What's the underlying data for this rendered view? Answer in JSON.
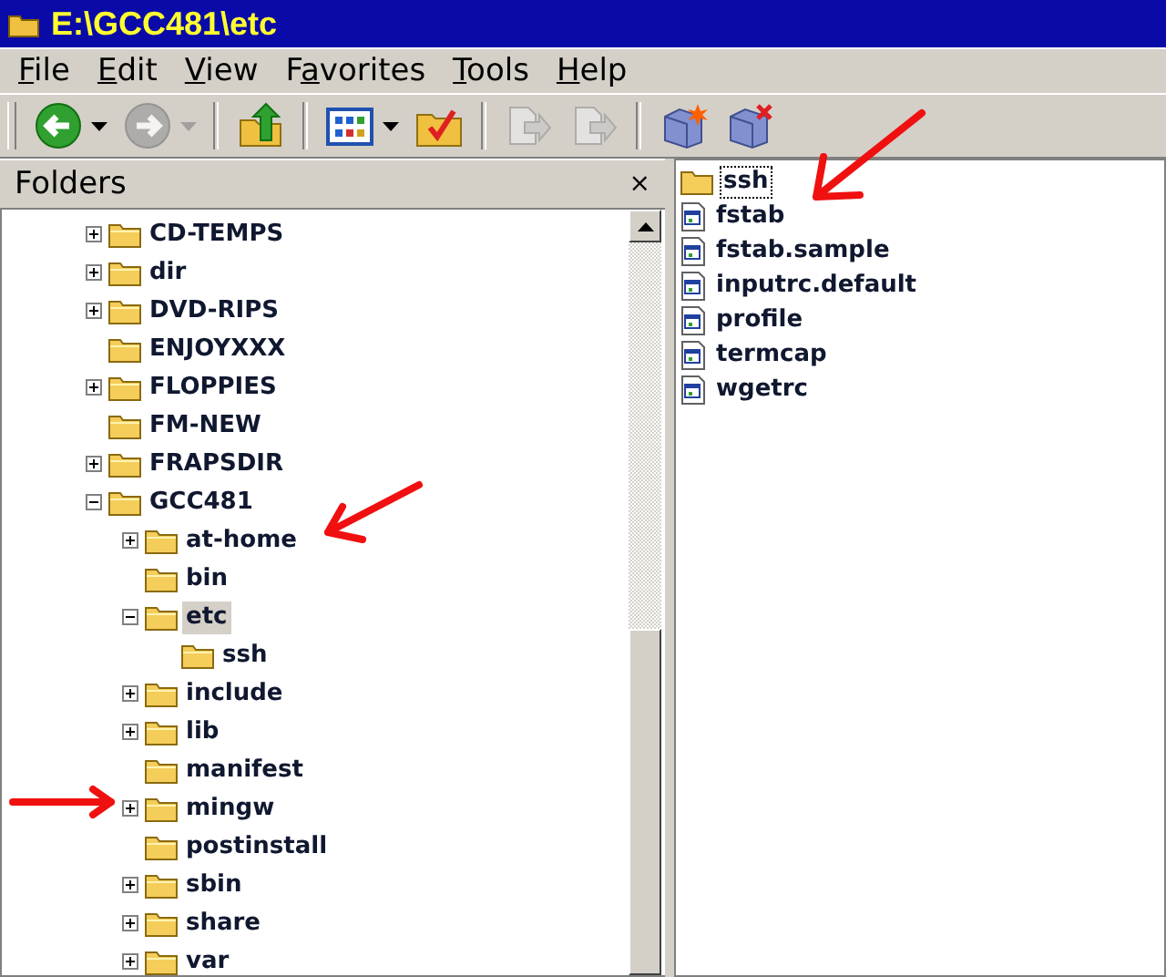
{
  "window": {
    "title": "E:\\GCC481\\etc"
  },
  "menu": [
    {
      "key": "F",
      "after": "ile"
    },
    {
      "key": "E",
      "after": "dit"
    },
    {
      "key": "V",
      "after": "iew"
    },
    {
      "before": "F",
      "key": "a",
      "after": "vorites"
    },
    {
      "key": "T",
      "after": "ools"
    },
    {
      "key": "H",
      "after": "elp"
    }
  ],
  "toolbar": [
    {
      "kind": "back",
      "disabled": false,
      "dropdown": true
    },
    {
      "kind": "forward",
      "disabled": true,
      "dropdown": true
    },
    {
      "kind": "separator"
    },
    {
      "kind": "up",
      "disabled": false,
      "dropdown": false
    },
    {
      "kind": "separator"
    },
    {
      "kind": "views",
      "disabled": false,
      "dropdown": true
    },
    {
      "kind": "folders",
      "disabled": false,
      "dropdown": false
    },
    {
      "kind": "separator"
    },
    {
      "kind": "move",
      "disabled": true,
      "dropdown": false
    },
    {
      "kind": "copy",
      "disabled": true,
      "dropdown": false
    },
    {
      "kind": "separator"
    },
    {
      "kind": "map-drive",
      "disabled": false,
      "dropdown": false
    },
    {
      "kind": "disconnect",
      "disabled": false,
      "dropdown": false
    }
  ],
  "folders_pane": {
    "title": "Folders",
    "close": "×",
    "tree": [
      {
        "name": "CD-TEMPS",
        "expandable": true,
        "selected": false
      },
      {
        "name": "dir",
        "expandable": true,
        "selected": false
      },
      {
        "name": "DVD-RIPS",
        "expandable": true,
        "selected": false
      },
      {
        "name": "ENJOYXXX",
        "expandable": false,
        "selected": false
      },
      {
        "name": "FLOPPIES",
        "expandable": true,
        "selected": false
      },
      {
        "name": "FM-NEW",
        "expandable": false,
        "selected": false
      },
      {
        "name": "FRAPSDIR",
        "expandable": true,
        "selected": false
      },
      {
        "name": "GCC481",
        "expandable": true,
        "expanded": true,
        "selected": false,
        "children": [
          {
            "name": "at-home",
            "expandable": true,
            "selected": false
          },
          {
            "name": "bin",
            "expandable": false,
            "selected": false
          },
          {
            "name": "etc",
            "expandable": true,
            "expanded": true,
            "selected": true,
            "children": [
              {
                "name": "ssh",
                "expandable": false,
                "selected": false
              }
            ]
          },
          {
            "name": "include",
            "expandable": true,
            "selected": false
          },
          {
            "name": "lib",
            "expandable": true,
            "selected": false
          },
          {
            "name": "manifest",
            "expandable": false,
            "selected": false
          },
          {
            "name": "mingw",
            "expandable": true,
            "selected": false
          },
          {
            "name": "postinstall",
            "expandable": false,
            "selected": false
          },
          {
            "name": "sbin",
            "expandable": true,
            "selected": false
          },
          {
            "name": "share",
            "expandable": true,
            "selected": false
          },
          {
            "name": "var",
            "expandable": true,
            "selected": false
          }
        ]
      }
    ]
  },
  "files": [
    {
      "name": "ssh",
      "kind": "folder",
      "focused": true
    },
    {
      "name": "fstab",
      "kind": "file",
      "focused": false
    },
    {
      "name": "fstab.sample",
      "kind": "file",
      "focused": false
    },
    {
      "name": "inputrc.default",
      "kind": "file",
      "focused": false
    },
    {
      "name": "profile",
      "kind": "file",
      "focused": false
    },
    {
      "name": "termcap",
      "kind": "file",
      "focused": false
    },
    {
      "name": "wgetrc",
      "kind": "file",
      "focused": false
    }
  ]
}
